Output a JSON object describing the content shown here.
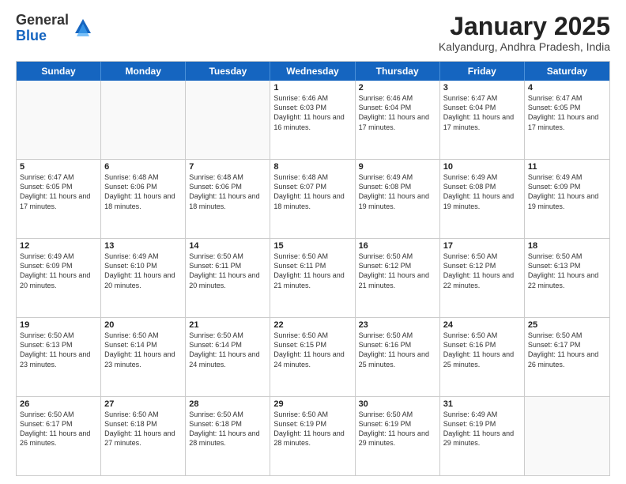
{
  "header": {
    "logo_general": "General",
    "logo_blue": "Blue",
    "month_title": "January 2025",
    "location": "Kalyandurg, Andhra Pradesh, India"
  },
  "weekdays": [
    "Sunday",
    "Monday",
    "Tuesday",
    "Wednesday",
    "Thursday",
    "Friday",
    "Saturday"
  ],
  "weeks": [
    [
      {
        "day": "",
        "text": ""
      },
      {
        "day": "",
        "text": ""
      },
      {
        "day": "",
        "text": ""
      },
      {
        "day": "1",
        "text": "Sunrise: 6:46 AM\nSunset: 6:03 PM\nDaylight: 11 hours and 16 minutes."
      },
      {
        "day": "2",
        "text": "Sunrise: 6:46 AM\nSunset: 6:04 PM\nDaylight: 11 hours and 17 minutes."
      },
      {
        "day": "3",
        "text": "Sunrise: 6:47 AM\nSunset: 6:04 PM\nDaylight: 11 hours and 17 minutes."
      },
      {
        "day": "4",
        "text": "Sunrise: 6:47 AM\nSunset: 6:05 PM\nDaylight: 11 hours and 17 minutes."
      }
    ],
    [
      {
        "day": "5",
        "text": "Sunrise: 6:47 AM\nSunset: 6:05 PM\nDaylight: 11 hours and 17 minutes."
      },
      {
        "day": "6",
        "text": "Sunrise: 6:48 AM\nSunset: 6:06 PM\nDaylight: 11 hours and 18 minutes."
      },
      {
        "day": "7",
        "text": "Sunrise: 6:48 AM\nSunset: 6:06 PM\nDaylight: 11 hours and 18 minutes."
      },
      {
        "day": "8",
        "text": "Sunrise: 6:48 AM\nSunset: 6:07 PM\nDaylight: 11 hours and 18 minutes."
      },
      {
        "day": "9",
        "text": "Sunrise: 6:49 AM\nSunset: 6:08 PM\nDaylight: 11 hours and 19 minutes."
      },
      {
        "day": "10",
        "text": "Sunrise: 6:49 AM\nSunset: 6:08 PM\nDaylight: 11 hours and 19 minutes."
      },
      {
        "day": "11",
        "text": "Sunrise: 6:49 AM\nSunset: 6:09 PM\nDaylight: 11 hours and 19 minutes."
      }
    ],
    [
      {
        "day": "12",
        "text": "Sunrise: 6:49 AM\nSunset: 6:09 PM\nDaylight: 11 hours and 20 minutes."
      },
      {
        "day": "13",
        "text": "Sunrise: 6:49 AM\nSunset: 6:10 PM\nDaylight: 11 hours and 20 minutes."
      },
      {
        "day": "14",
        "text": "Sunrise: 6:50 AM\nSunset: 6:11 PM\nDaylight: 11 hours and 20 minutes."
      },
      {
        "day": "15",
        "text": "Sunrise: 6:50 AM\nSunset: 6:11 PM\nDaylight: 11 hours and 21 minutes."
      },
      {
        "day": "16",
        "text": "Sunrise: 6:50 AM\nSunset: 6:12 PM\nDaylight: 11 hours and 21 minutes."
      },
      {
        "day": "17",
        "text": "Sunrise: 6:50 AM\nSunset: 6:12 PM\nDaylight: 11 hours and 22 minutes."
      },
      {
        "day": "18",
        "text": "Sunrise: 6:50 AM\nSunset: 6:13 PM\nDaylight: 11 hours and 22 minutes."
      }
    ],
    [
      {
        "day": "19",
        "text": "Sunrise: 6:50 AM\nSunset: 6:13 PM\nDaylight: 11 hours and 23 minutes."
      },
      {
        "day": "20",
        "text": "Sunrise: 6:50 AM\nSunset: 6:14 PM\nDaylight: 11 hours and 23 minutes."
      },
      {
        "day": "21",
        "text": "Sunrise: 6:50 AM\nSunset: 6:14 PM\nDaylight: 11 hours and 24 minutes."
      },
      {
        "day": "22",
        "text": "Sunrise: 6:50 AM\nSunset: 6:15 PM\nDaylight: 11 hours and 24 minutes."
      },
      {
        "day": "23",
        "text": "Sunrise: 6:50 AM\nSunset: 6:16 PM\nDaylight: 11 hours and 25 minutes."
      },
      {
        "day": "24",
        "text": "Sunrise: 6:50 AM\nSunset: 6:16 PM\nDaylight: 11 hours and 25 minutes."
      },
      {
        "day": "25",
        "text": "Sunrise: 6:50 AM\nSunset: 6:17 PM\nDaylight: 11 hours and 26 minutes."
      }
    ],
    [
      {
        "day": "26",
        "text": "Sunrise: 6:50 AM\nSunset: 6:17 PM\nDaylight: 11 hours and 26 minutes."
      },
      {
        "day": "27",
        "text": "Sunrise: 6:50 AM\nSunset: 6:18 PM\nDaylight: 11 hours and 27 minutes."
      },
      {
        "day": "28",
        "text": "Sunrise: 6:50 AM\nSunset: 6:18 PM\nDaylight: 11 hours and 28 minutes."
      },
      {
        "day": "29",
        "text": "Sunrise: 6:50 AM\nSunset: 6:19 PM\nDaylight: 11 hours and 28 minutes."
      },
      {
        "day": "30",
        "text": "Sunrise: 6:50 AM\nSunset: 6:19 PM\nDaylight: 11 hours and 29 minutes."
      },
      {
        "day": "31",
        "text": "Sunrise: 6:49 AM\nSunset: 6:19 PM\nDaylight: 11 hours and 29 minutes."
      },
      {
        "day": "",
        "text": ""
      }
    ]
  ]
}
